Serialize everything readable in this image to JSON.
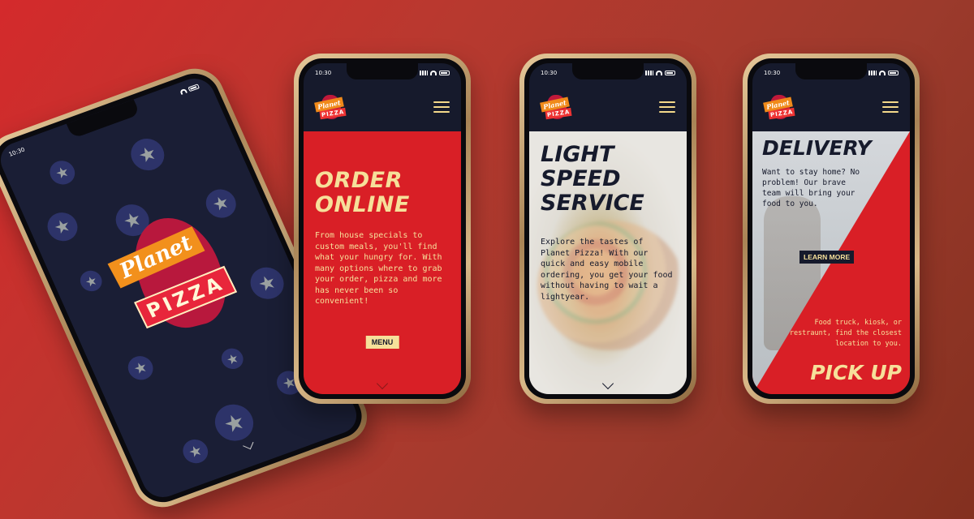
{
  "status": {
    "time": "10:30"
  },
  "brand": {
    "line1": "Planet",
    "line2": "PIZZA"
  },
  "screen_order": {
    "title_line1": "ORDER",
    "title_line2": "ONLINE",
    "body": "From house specials to custom meals, you'll find what your hungry for. With many options where to grab your order, pizza and more has never been so convenient!",
    "button_label": "MENU"
  },
  "screen_speed": {
    "title_line1": "LIGHT",
    "title_line2": "SPEED",
    "title_line3": "SERVICE",
    "body": "Explore the tastes of Planet Pizza! With our quick and easy mobile ordering, you get your food without having to wait a lightyear."
  },
  "screen_delivery": {
    "title": "DELIVERY",
    "body": "Want to stay home? No problem! Our brave team will bring your food to you.",
    "button_label": "LEARN MORE",
    "pickup_text": "Food truck, kiosk, or restraunt, find the closest location to you.",
    "pickup_title": "PICK UP"
  },
  "colors": {
    "navy": "#161a2c",
    "red": "#d91f26",
    "cream": "#f6e09a",
    "orange": "#f2901c"
  }
}
